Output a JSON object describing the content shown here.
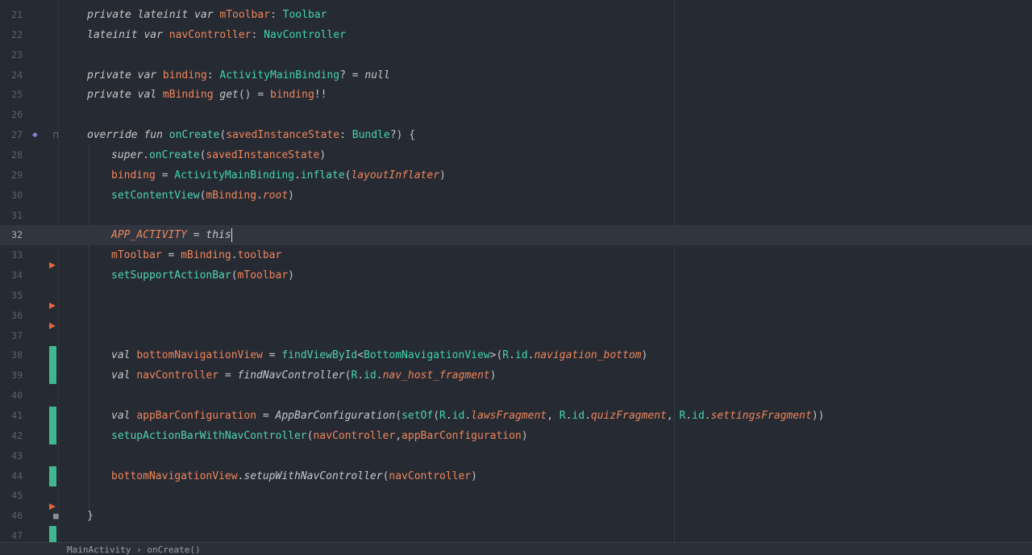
{
  "gutter_marks": {
    "fold_icon": "fold-icon",
    "override_icon": "override-icon"
  },
  "colors": {
    "background": "#262a33",
    "current_line": "#31353f",
    "keyword": "#c9c9c9",
    "type": "#41d4b0",
    "property": "#f0865a",
    "vcs_added": "#3fb88f",
    "bookmark": "#e2663b"
  },
  "lines": [
    {
      "n": "21",
      "tokens": [
        [
          "kw",
          "private lateinit var "
        ],
        [
          "pr",
          "mToolbar"
        ],
        [
          "pl",
          ": "
        ],
        [
          "ty",
          "Toolbar"
        ]
      ],
      "indent": 1
    },
    {
      "n": "22",
      "tokens": [
        [
          "kw",
          "lateinit var "
        ],
        [
          "pr",
          "navController"
        ],
        [
          "pl",
          ": "
        ],
        [
          "ty",
          "NavController"
        ]
      ],
      "indent": 1
    },
    {
      "n": "23",
      "tokens": [],
      "indent": 1
    },
    {
      "n": "24",
      "tokens": [
        [
          "kw",
          "private var "
        ],
        [
          "pr",
          "binding"
        ],
        [
          "pl",
          ": "
        ],
        [
          "ty",
          "ActivityMainBinding"
        ],
        [
          "pl",
          "? = "
        ],
        [
          "kw",
          "null"
        ]
      ],
      "indent": 1
    },
    {
      "n": "25",
      "tokens": [
        [
          "kw",
          "private val "
        ],
        [
          "pr",
          "mBinding "
        ],
        [
          "fni",
          "get"
        ],
        [
          "pl",
          "() = "
        ],
        [
          "pr",
          "binding"
        ],
        [
          "pl",
          "!!"
        ]
      ],
      "indent": 1
    },
    {
      "n": "26",
      "tokens": [],
      "indent": 1
    },
    {
      "n": "27",
      "tokens": [
        [
          "kw",
          "override fun "
        ],
        [
          "fn",
          "onCreate"
        ],
        [
          "pl",
          "("
        ],
        [
          "pr",
          "savedInstanceState"
        ],
        [
          "pl",
          ": "
        ],
        [
          "ty",
          "Bundle"
        ],
        [
          "pl",
          "?) {"
        ]
      ],
      "indent": 1
    },
    {
      "n": "28",
      "tokens": [
        [
          "kw",
          "super"
        ],
        [
          "pl",
          "."
        ],
        [
          "fn",
          "onCreate"
        ],
        [
          "pl",
          "("
        ],
        [
          "pr",
          "savedInstanceState"
        ],
        [
          "pl",
          ")"
        ]
      ],
      "indent": 2
    },
    {
      "n": "29",
      "tokens": [
        [
          "pr",
          "binding"
        ],
        [
          "pl",
          " = "
        ],
        [
          "ty",
          "ActivityMainBinding"
        ],
        [
          "pl",
          "."
        ],
        [
          "fn",
          "inflate"
        ],
        [
          "pl",
          "("
        ],
        [
          "pri",
          "layoutInflater"
        ],
        [
          "pl",
          ")"
        ]
      ],
      "indent": 2
    },
    {
      "n": "30",
      "tokens": [
        [
          "fn",
          "setContentView"
        ],
        [
          "pl",
          "("
        ],
        [
          "pr",
          "mBinding"
        ],
        [
          "pl",
          "."
        ],
        [
          "pri",
          "root"
        ],
        [
          "pl",
          ")"
        ]
      ],
      "indent": 2
    },
    {
      "n": "31",
      "tokens": [],
      "indent": 2
    },
    {
      "n": "32",
      "tokens": [
        [
          "cst",
          "APP_ACTIVITY"
        ],
        [
          "pl",
          " = "
        ],
        [
          "kw",
          "this"
        ]
      ],
      "indent": 2,
      "current": true
    },
    {
      "n": "33",
      "tokens": [
        [
          "pr",
          "mToolbar"
        ],
        [
          "pl",
          " = "
        ],
        [
          "pr",
          "mBinding"
        ],
        [
          "pl",
          "."
        ],
        [
          "pr",
          "toolbar"
        ]
      ],
      "indent": 2
    },
    {
      "n": "34",
      "tokens": [
        [
          "fn",
          "setSupportActionBar"
        ],
        [
          "pl",
          "("
        ],
        [
          "pr",
          "mToolbar"
        ],
        [
          "pl",
          ")"
        ]
      ],
      "indent": 2
    },
    {
      "n": "35",
      "tokens": [],
      "indent": 2
    },
    {
      "n": "36",
      "tokens": [],
      "indent": 2
    },
    {
      "n": "37",
      "tokens": [],
      "indent": 2
    },
    {
      "n": "38",
      "tokens": [
        [
          "kw",
          "val "
        ],
        [
          "pr",
          "bottomNavigationView"
        ],
        [
          "pl",
          " = "
        ],
        [
          "fn",
          "findViewById"
        ],
        [
          "pl",
          "<"
        ],
        [
          "ty",
          "BottomNavigationView"
        ],
        [
          "pl",
          ">("
        ],
        [
          "ty",
          "R"
        ],
        [
          "pl",
          "."
        ],
        [
          "ty",
          "id"
        ],
        [
          "pl",
          "."
        ],
        [
          "pri",
          "navigation_bottom"
        ],
        [
          "pl",
          ")"
        ]
      ],
      "indent": 2
    },
    {
      "n": "39",
      "tokens": [
        [
          "kw",
          "val "
        ],
        [
          "pr",
          "navController"
        ],
        [
          "pl",
          " = "
        ],
        [
          "fni",
          "findNavController"
        ],
        [
          "pl",
          "("
        ],
        [
          "ty",
          "R"
        ],
        [
          "pl",
          "."
        ],
        [
          "ty",
          "id"
        ],
        [
          "pl",
          "."
        ],
        [
          "pri",
          "nav_host_fragment"
        ],
        [
          "pl",
          ")"
        ]
      ],
      "indent": 2
    },
    {
      "n": "40",
      "tokens": [],
      "indent": 2
    },
    {
      "n": "41",
      "tokens": [
        [
          "kw",
          "val "
        ],
        [
          "pr",
          "appBarConfiguration"
        ],
        [
          "pl",
          " = "
        ],
        [
          "fni",
          "AppBarConfiguration"
        ],
        [
          "pl",
          "("
        ],
        [
          "fn",
          "setOf"
        ],
        [
          "pl",
          "("
        ],
        [
          "ty",
          "R"
        ],
        [
          "pl",
          "."
        ],
        [
          "ty",
          "id"
        ],
        [
          "pl",
          "."
        ],
        [
          "pri",
          "lawsFragment"
        ],
        [
          "pl",
          ", "
        ],
        [
          "ty",
          "R"
        ],
        [
          "pl",
          "."
        ],
        [
          "ty",
          "id"
        ],
        [
          "pl",
          "."
        ],
        [
          "pri",
          "quizFragment"
        ],
        [
          "pl",
          ", "
        ],
        [
          "ty",
          "R"
        ],
        [
          "pl",
          "."
        ],
        [
          "ty",
          "id"
        ],
        [
          "pl",
          "."
        ],
        [
          "pri",
          "settingsFragment"
        ],
        [
          "pl",
          "))"
        ]
      ],
      "indent": 2
    },
    {
      "n": "42",
      "tokens": [
        [
          "fn",
          "setupActionBarWithNavController"
        ],
        [
          "pl",
          "("
        ],
        [
          "pr",
          "navController"
        ],
        [
          "pl",
          ","
        ],
        [
          "pr",
          "appBarConfiguration"
        ],
        [
          "pl",
          ")"
        ]
      ],
      "indent": 2
    },
    {
      "n": "43",
      "tokens": [],
      "indent": 2
    },
    {
      "n": "44",
      "tokens": [
        [
          "pr",
          "bottomNavigationView"
        ],
        [
          "pl",
          "."
        ],
        [
          "fni",
          "setupWithNavController"
        ],
        [
          "pl",
          "("
        ],
        [
          "pr",
          "navController"
        ],
        [
          "pl",
          ")"
        ]
      ],
      "indent": 2
    },
    {
      "n": "45",
      "tokens": [],
      "indent": 2
    },
    {
      "n": "46",
      "tokens": [
        [
          "pl",
          "}"
        ]
      ],
      "indent": 1
    },
    {
      "n": "47",
      "tokens": [],
      "indent": 1
    }
  ],
  "statusbar": {
    "breadcrumb": "MainActivity  ›  onCreate()"
  }
}
